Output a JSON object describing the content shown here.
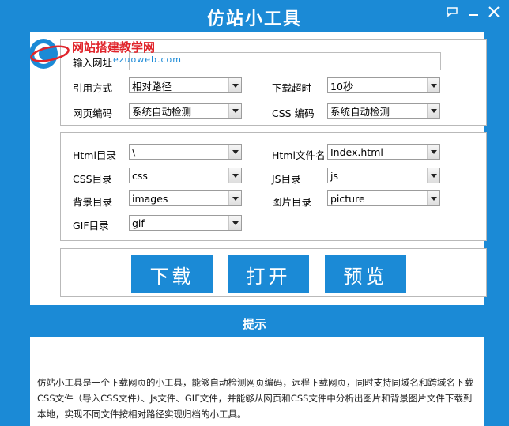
{
  "window": {
    "title": "仿站小工具"
  },
  "logo": {
    "brand": "网站搭建教学网",
    "url": "ezuoweb.com"
  },
  "settings": {
    "input_url_label": "输入网址",
    "input_url_value": "",
    "ref_mode_label": "引用方式",
    "ref_mode_value": "相对路径",
    "timeout_label": "下载超时",
    "timeout_value": "10秒",
    "page_encoding_label": "网页编码",
    "page_encoding_value": "系统自动检测",
    "css_encoding_label": "CSS 编码",
    "css_encoding_value": "系统自动检测"
  },
  "directories": {
    "html_dir_label": "Html目录",
    "html_dir_value": "\\",
    "html_file_label": "Html文件名",
    "html_file_value": "Index.html",
    "css_dir_label": "CSS目录",
    "css_dir_value": "css",
    "js_dir_label": "JS目录",
    "js_dir_value": "js",
    "bg_dir_label": "背景目录",
    "bg_dir_value": "images",
    "img_dir_label": "图片目录",
    "img_dir_value": "picture",
    "gif_dir_label": "GIF目录",
    "gif_dir_value": "gif"
  },
  "actions": {
    "download": "下载",
    "open": "打开",
    "preview": "预览"
  },
  "hint": {
    "title": "提示",
    "text": "仿站小工具是一个下载网页的小工具，能够自动检测网页编码，远程下载网页，同时支持同域名和跨域名下载CSS文件（导入CSS文件）、Js文件、GIF文件，并能够从网页和CSS文件中分析出图片和背景图片文件下载到本地，实现不同文件按相对路径实现归档的小工具。"
  },
  "colors": {
    "accent": "#1b8ad6",
    "brand_red": "#e0242b"
  }
}
